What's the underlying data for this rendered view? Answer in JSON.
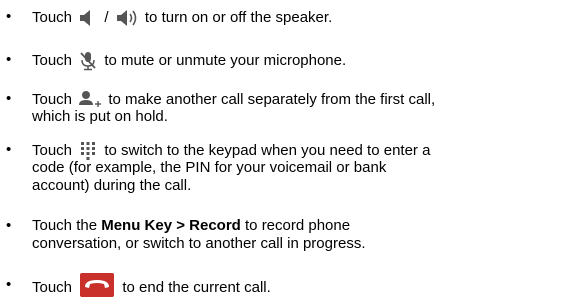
{
  "bullet_char": "•",
  "items": [
    {
      "touch": "Touch",
      "slash": "/",
      "rest": "to turn on or off the speaker."
    },
    {
      "touch": "Touch",
      "rest": "to mute or unmute your microphone."
    },
    {
      "touch": "Touch",
      "rest": "to make another call separately from the first call,",
      "line2": "which is put on hold."
    },
    {
      "touch": "Touch",
      "rest": "to switch to the keypad when you need to enter a",
      "line2": "code (for example, the PIN for your voicemail or bank",
      "line3": "account) during the call."
    },
    {
      "pre": "Touch the ",
      "bold": "Menu Key > Record",
      "rest": " to record phone",
      "line2": "conversation, or switch to another call in progress."
    },
    {
      "touch": "Touch",
      "rest": "to end the current call."
    }
  ],
  "icons": {
    "speaker_off": "speaker-off-icon",
    "speaker_on": "speaker-on-icon",
    "mute": "microphone-mute-icon",
    "add_call": "add-call-icon",
    "keypad": "keypad-icon",
    "end_call": "end-call-icon"
  },
  "colors": {
    "end_call": "#c9302c",
    "icon_gray": "#555555"
  }
}
